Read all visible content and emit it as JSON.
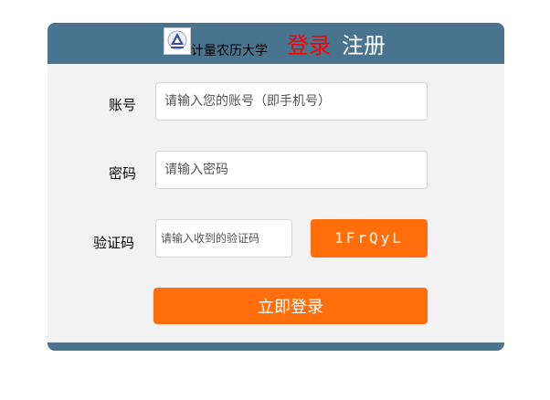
{
  "header": {
    "school_name": "计量农历大学",
    "tab_login": "登录",
    "tab_register": "注册"
  },
  "form": {
    "account_label": "账号",
    "account_placeholder": "请输入您的账号（即手机号）",
    "password_label": "密码",
    "password_placeholder": "请输入密码",
    "code_label": "验证码",
    "code_placeholder": "请输入收到的验证码",
    "captcha_text": "1FrQyL",
    "submit_label": "立即登录"
  },
  "colors": {
    "header_bg": "#48748f",
    "accent": "#ff6e0b",
    "active_tab": "#ff0000"
  },
  "icons": {
    "logo": "university-logo-icon"
  }
}
